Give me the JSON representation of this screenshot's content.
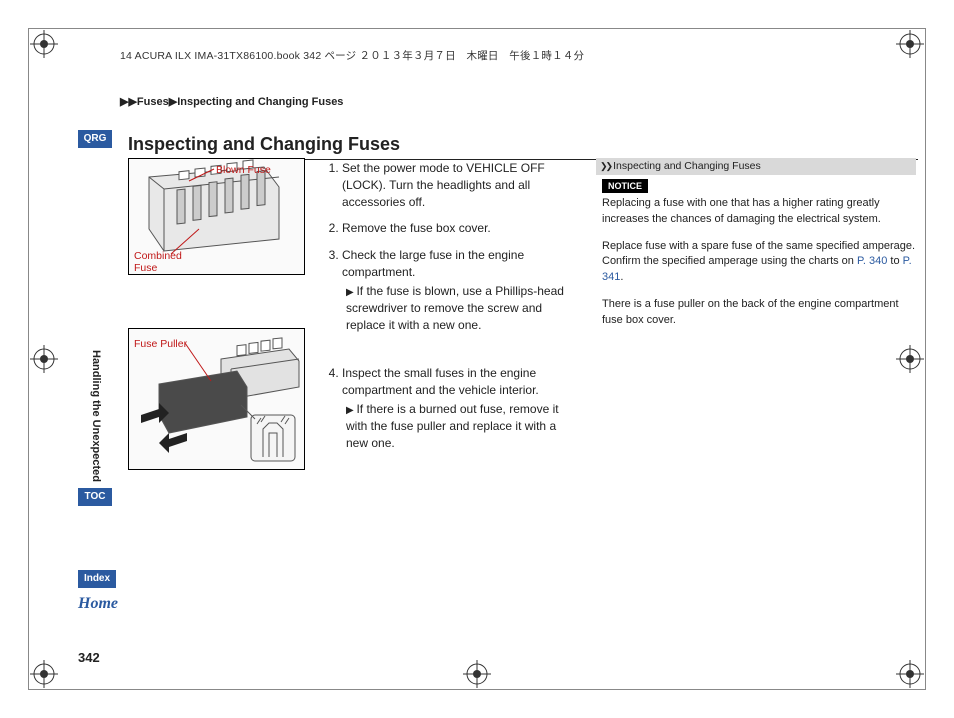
{
  "meta": {
    "header_text": "14 ACURA ILX IMA-31TX86100.book  342 ページ  ２０１３年３月７日　木曜日　午後１時１４分"
  },
  "breadcrumb": {
    "item1": "Fuses",
    "item2": "Inspecting and Changing Fuses"
  },
  "nav": {
    "qrg": "QRG",
    "toc": "TOC",
    "index": "Index",
    "home": "Home"
  },
  "side_section": "Handling the Unexpected",
  "title": "Inspecting and Changing Fuses",
  "diagram1": {
    "blown_label": "Blown Fuse",
    "combined_label": "Combined Fuse"
  },
  "diagram2": {
    "puller_label": "Fuse Puller"
  },
  "steps": {
    "s1": "Set the power mode to VEHICLE OFF (LOCK). Turn the headlights and all accessories off.",
    "s2": "Remove the fuse box cover.",
    "s3": "Check the large fuse in the engine compartment.",
    "s3_sub": "If the fuse is blown, use a Phillips-head screwdriver to remove the screw and replace it with a new one.",
    "s4": "Inspect the small fuses in the engine compartment and the vehicle interior.",
    "s4_sub": "If there is a burned out fuse, remove it with the fuse puller and replace it with a new one."
  },
  "info": {
    "header": "Inspecting and Changing Fuses",
    "notice": "NOTICE",
    "notice_text": "Replacing a fuse with one that has a higher rating greatly increases the chances of damaging the electrical system.",
    "para2a": "Replace fuse with a spare fuse of the same specified amperage.",
    "para2b": "Confirm the specified amperage using the charts on ",
    "link1": "P. 340",
    "to": " to ",
    "link2": "P. 341",
    "period": ".",
    "para3": "There is a fuse puller on the back of the engine compartment fuse box cover."
  },
  "page_number": "342"
}
